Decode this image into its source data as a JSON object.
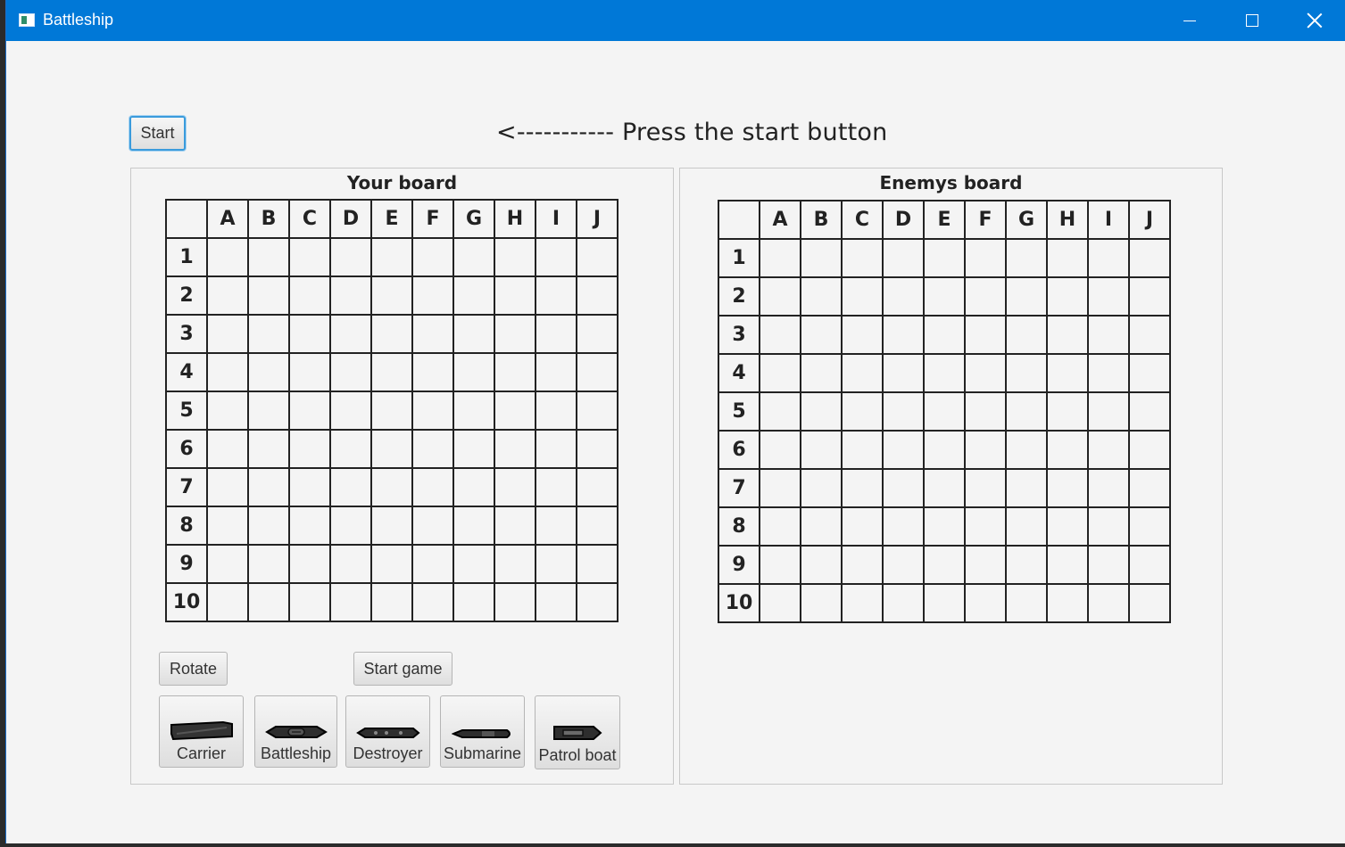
{
  "window": {
    "title": "Battleship"
  },
  "controls": {
    "start_label": "Start",
    "message": "<----------- Press the start button",
    "rotate_label": "Rotate",
    "start_game_label": "Start game"
  },
  "boards": {
    "player_title": "Your board",
    "enemy_title": "Enemys board",
    "columns": [
      "A",
      "B",
      "C",
      "D",
      "E",
      "F",
      "G",
      "H",
      "I",
      "J"
    ],
    "rows": [
      "1",
      "2",
      "3",
      "4",
      "5",
      "6",
      "7",
      "8",
      "9",
      "10"
    ]
  },
  "ships": [
    {
      "label": "Carrier",
      "icon": "carrier-icon"
    },
    {
      "label": "Battleship",
      "icon": "battleship-icon"
    },
    {
      "label": "Destroyer",
      "icon": "destroyer-icon"
    },
    {
      "label": "Submarine",
      "icon": "submarine-icon"
    },
    {
      "label": "Patrol boat",
      "icon": "patrol-boat-icon"
    }
  ],
  "colors": {
    "titlebar": "#0078d7",
    "background": "#f4f4f4",
    "focus": "#3a9bdc"
  }
}
